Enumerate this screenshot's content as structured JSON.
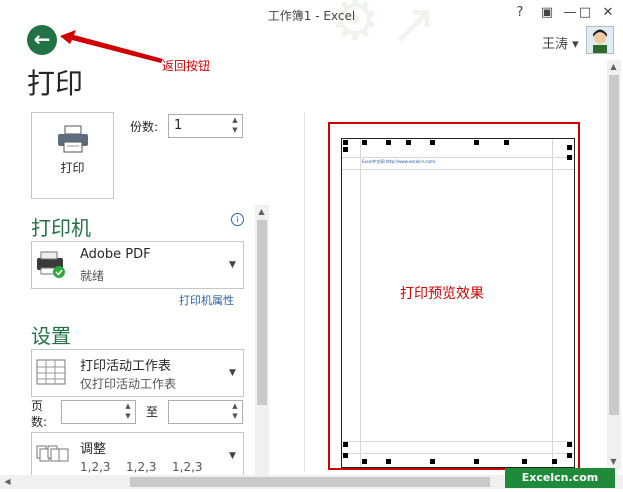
{
  "window": {
    "title": "工作簿1 - Excel",
    "help": "?",
    "minimize": "—",
    "maximize": "□",
    "close": "✕"
  },
  "back": {
    "glyph": "←",
    "annotation": "返回按钮"
  },
  "user": {
    "name": "王涛 ▾"
  },
  "page_title": "打印",
  "print_button": {
    "label": "打印"
  },
  "copies": {
    "label": "份数:",
    "value": "1"
  },
  "printer": {
    "heading": "打印机",
    "info_glyph": "i",
    "name": "Adobe PDF",
    "status": "就绪",
    "properties_link": "打印机属性"
  },
  "settings": {
    "heading": "设置",
    "scope": {
      "title": "打印活动工作表",
      "subtitle": "仅打印活动工作表"
    },
    "pages": {
      "label": "页数:",
      "to_label": "至"
    },
    "collate": {
      "title": "调整",
      "seq": [
        "1,2,3",
        "1,2,3",
        "1,2,3"
      ]
    }
  },
  "preview": {
    "header_text": "Excel中文网  http://www.excelcn.com/",
    "annotation": "打印预览效果"
  },
  "footer": {
    "logo": "Excelcn.com"
  },
  "colors": {
    "accent": "#217346",
    "annotation": "#d00000",
    "link": "#2a63a8"
  }
}
